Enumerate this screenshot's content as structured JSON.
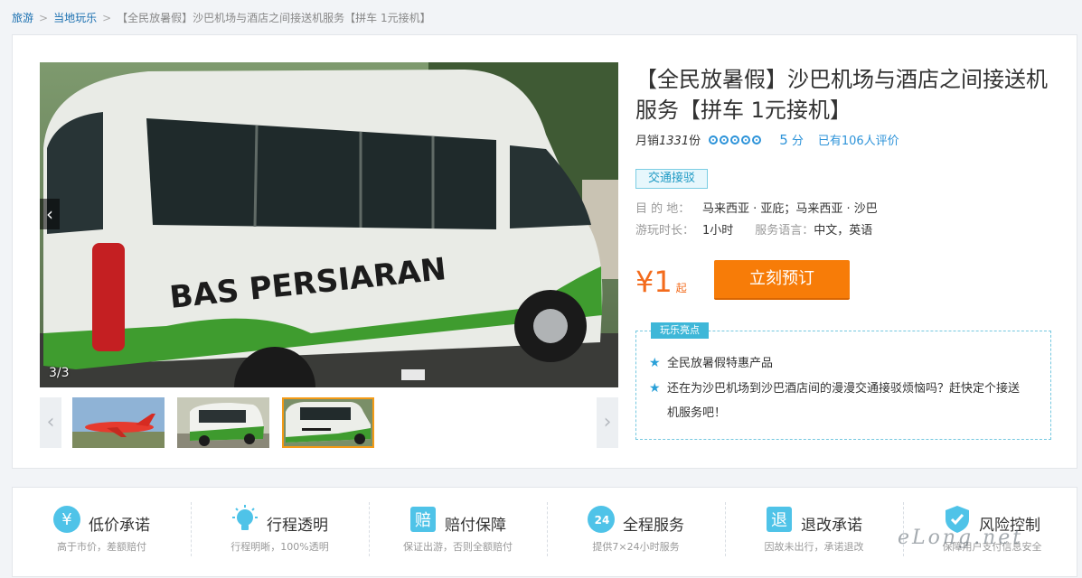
{
  "breadcrumb": {
    "items": [
      "旅游",
      "当地玩乐"
    ],
    "separator": ">",
    "current": "【全民放暑假】沙巴机场与酒店之间接送机服务【拼车 1元接机】"
  },
  "gallery": {
    "main_photo_text": "BAS PERSIARAN",
    "counter": "3/3",
    "prev_icon": "‹",
    "thumb_prev_icon": "‹",
    "thumb_next_icon": "›",
    "selected_index": 2
  },
  "product": {
    "title": "【全民放暑假】沙巴机场与酒店之间接送机服务【拼车 1元接机】",
    "sales_label": "月销",
    "sales_count": "1331",
    "sales_unit": "份",
    "rating_score": "5",
    "rating_unit": "分",
    "reviews": "已有106人评价",
    "category_tag": "交通接驳",
    "destination_label": "目 的 地：",
    "destination_value": "马来西亚 · 亚庇；马来西亚 · 沙巴",
    "duration_label": "游玩时长：",
    "duration_value": "1小时",
    "language_label": "服务语言：",
    "language_value": "中文，英语",
    "price_symbol": "¥1",
    "price_suffix": "起",
    "book_button": "立刻预订"
  },
  "highlights": {
    "label": "玩乐亮点",
    "items": [
      "全民放暑假特惠产品",
      "还在为沙巴机场到沙巴酒店间的漫漫交通接驳烦恼吗？赶快定个接送机服务吧！"
    ]
  },
  "features": [
    {
      "icon": "yen-icon",
      "name": "低价承诺",
      "desc": "高于市价，差额赔付"
    },
    {
      "icon": "lightbulb-icon",
      "name": "行程透明",
      "desc": "行程明晰，100%透明"
    },
    {
      "icon": "compensation-icon",
      "name": "赔付保障",
      "desc": "保证出游，否则全额赔付"
    },
    {
      "icon": "phone-24h-icon",
      "name": "全程服务",
      "desc": "提供7×24小时服务"
    },
    {
      "icon": "refund-icon",
      "name": "退改承诺",
      "desc": "因故未出行，承诺退改"
    },
    {
      "icon": "shield-icon",
      "name": "风险控制",
      "desc": "保障用户支付信息安全"
    }
  ],
  "watermark": "eLong.net",
  "colors": {
    "accent_orange": "#f77c08",
    "price_orange": "#f36b1c",
    "link_blue": "#2d93d9",
    "tag_cyan": "#3eb7d8",
    "feature_icon": "#4fc3e8"
  }
}
